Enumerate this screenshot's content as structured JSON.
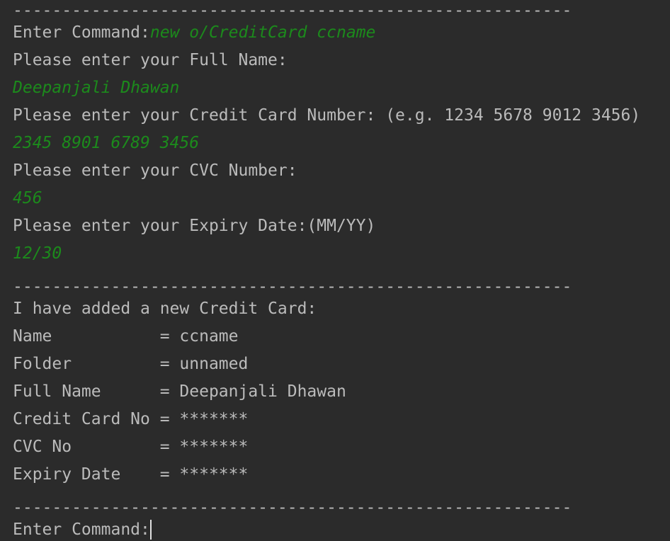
{
  "terminal": {
    "separator_1": "---------------------------------------------------------",
    "cmd_prompt": "Enter Command:",
    "cmd_input": "new o/CreditCard ccname",
    "prompt_full_name": "Please enter your Full Name:",
    "input_full_name": "Deepanjali Dhawan",
    "prompt_card_number": "Please enter your Credit Card Number: (e.g. 1234 5678 9012 3456)",
    "input_card_number": "2345 8901 6789 3456",
    "prompt_cvc": "Please enter your CVC Number:",
    "input_cvc": "456",
    "prompt_expiry": "Please enter your Expiry Date:(MM/YY)",
    "input_expiry": "12/30",
    "separator_2": "---------------------------------------------------------",
    "added_message": "I have added a new Credit Card:",
    "details": [
      "Name           = ccname",
      "Folder         = unnamed",
      "Full Name      = Deepanjali Dhawan",
      "Credit Card No = *******",
      "CVC No         = *******",
      "Expiry Date    = *******"
    ],
    "separator_3": "---------------------------------------------------------",
    "final_prompt": "Enter Command:"
  }
}
